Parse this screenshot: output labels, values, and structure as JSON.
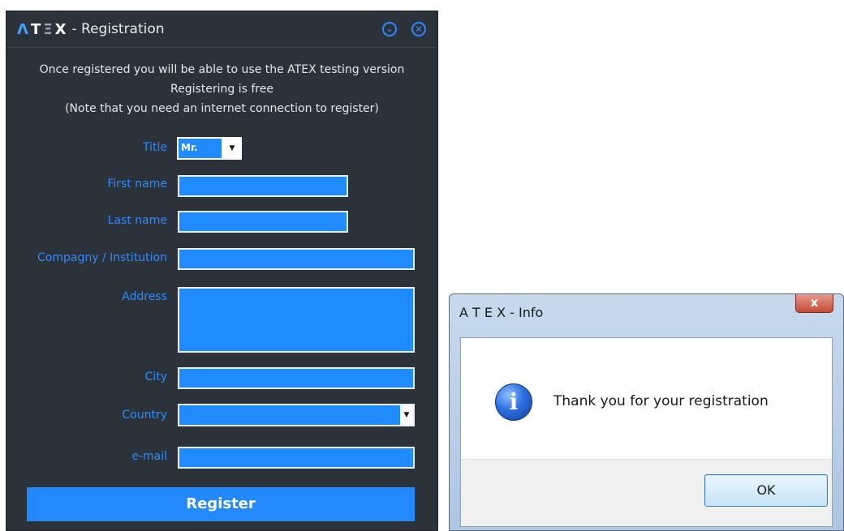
{
  "registration": {
    "brand": {
      "a": "Λ",
      "t": "T",
      "e": "Ξ",
      "x": "X"
    },
    "title": "- Registration",
    "minimize_icon": "chevron-down-circle-icon",
    "close_icon": "close-circle-icon",
    "intro": [
      "Once registered you will be able to use the ATEX testing version",
      "Registering is free",
      "(Note that you need an internet connection to register)"
    ],
    "labels": {
      "title": "Title",
      "first_name": "First name",
      "last_name": "Last name",
      "company": "Compagny / Institution",
      "address": "Address",
      "city": "City",
      "country": "Country",
      "email": "e-mail"
    },
    "title_value": "Mr.",
    "register_label": "Register",
    "colors": {
      "background": "#2c323a",
      "accent": "#2389ff",
      "field": "#1f8bff"
    }
  },
  "info_dialog": {
    "title": "A T E X - Info",
    "close_label": "x",
    "message": "Thank you for your registration",
    "ok_label": "OK",
    "icon": "information-icon"
  }
}
